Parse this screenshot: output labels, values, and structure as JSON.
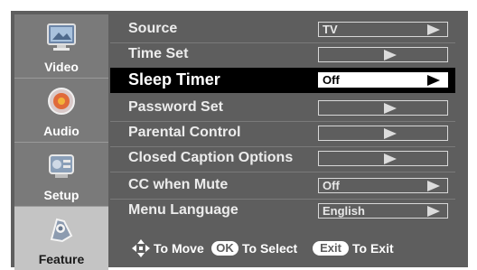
{
  "sidebar": {
    "items": [
      {
        "label": "Video",
        "icon": "video-icon"
      },
      {
        "label": "Audio",
        "icon": "audio-icon"
      },
      {
        "label": "Setup",
        "icon": "setup-icon"
      },
      {
        "label": "Feature",
        "icon": "feature-icon"
      }
    ]
  },
  "menu": {
    "items": [
      {
        "label": "Source",
        "value": "TV"
      },
      {
        "label": "Time Set",
        "value": ""
      },
      {
        "label": "Sleep Timer",
        "value": "Off"
      },
      {
        "label": "Password Set",
        "value": ""
      },
      {
        "label": "Parental Control",
        "value": ""
      },
      {
        "label": "Closed Caption Options",
        "value": ""
      },
      {
        "label": "CC when Mute",
        "value": "Off"
      },
      {
        "label": "Menu Language",
        "value": "English"
      }
    ]
  },
  "footer": {
    "move_text": "To Move",
    "ok_key": "OK",
    "select_text": "To Select",
    "exit_key": "Exit",
    "exit_text": "To Exit"
  },
  "colors": {
    "panel": "#5e5e5e",
    "sidebar": "#7a7a7a",
    "sidebar_active": "#c4c4c4",
    "highlight": "#000000"
  }
}
